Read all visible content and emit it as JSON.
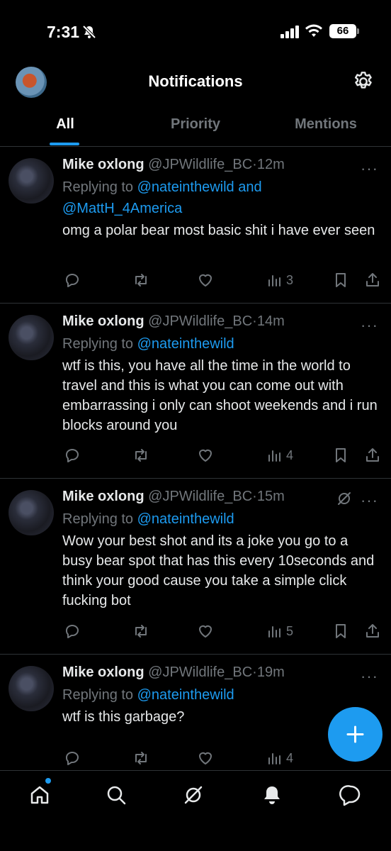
{
  "status": {
    "time": "7:31",
    "battery": "66"
  },
  "header": {
    "title": "Notifications"
  },
  "tabs": [
    {
      "label": "All"
    },
    {
      "label": "Priority"
    },
    {
      "label": "Mentions"
    }
  ],
  "notifications": [
    {
      "author": "Mike oxlong",
      "handle": "@JPWildlife_BC",
      "time": "12m",
      "replying_prefix": "Replying to",
      "mention1": "@nateinthewild",
      "joiner": "and",
      "mention2": "@MattH_4America",
      "text": "omg a polar bear most basic shit i have ever seen",
      "views": "3"
    },
    {
      "author": "Mike oxlong",
      "handle": "@JPWildlife_BC",
      "time": "14m",
      "replying_prefix": "Replying to",
      "mention1": "@nateinthewild",
      "text": "wtf is this, you have all the time in the world to travel and this is what you can come out with embarrassing i only can shoot weekends and i run blocks around you",
      "views": "4"
    },
    {
      "author": "Mike oxlong",
      "handle": "@JPWildlife_BC",
      "time": "15m",
      "replying_prefix": "Replying to",
      "mention1": "@nateinthewild",
      "text": "Wow your best shot and its a joke you go to a busy bear spot that has this every 10seconds and think your good cause you take a simple click fucking bot",
      "views": "5"
    },
    {
      "author": "Mike oxlong",
      "handle": "@JPWildlife_BC",
      "time": "19m",
      "replying_prefix": "Replying to",
      "mention1": "@nateinthewild",
      "text": "wtf is this garbage?",
      "views": "4"
    }
  ],
  "colors": {
    "accent": "#1d9bf0",
    "muted": "#71767b",
    "background": "#000000"
  }
}
